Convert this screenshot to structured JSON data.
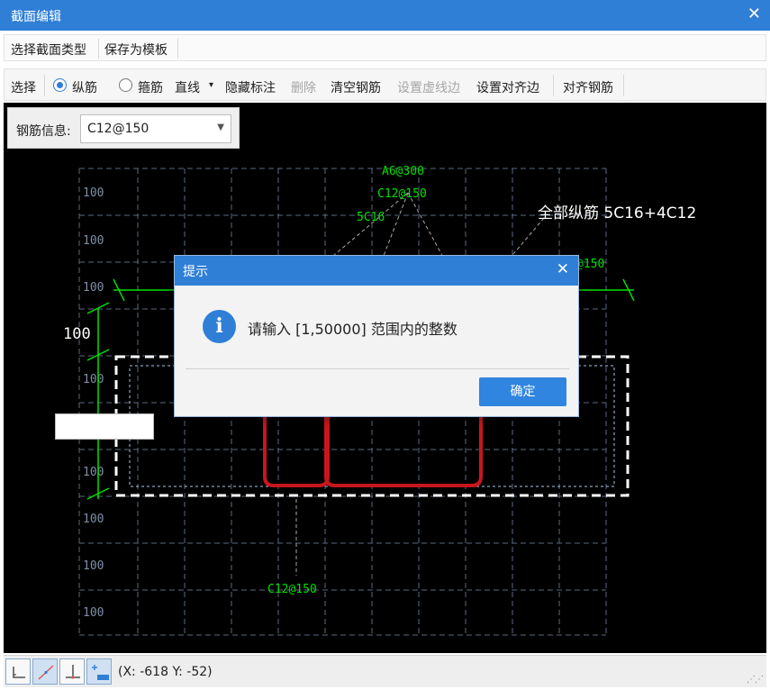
{
  "window": {
    "title": "截面编辑",
    "close_icon": "close-icon"
  },
  "menu": {
    "select_section_type": "选择截面类型",
    "save_as_template": "保存为模板"
  },
  "toolbar": {
    "select": "选择",
    "longitudinal": "纵筋",
    "stirrup": "箍筋",
    "line": "直线",
    "line_arrow": "▾",
    "hide_labels": "隐藏标注",
    "delete": "删除",
    "clear_rebar": "清空钢筋",
    "set_dashed_edge": "设置虚线边",
    "set_align_edge": "设置对齐边",
    "align_rebar": "对齐钢筋"
  },
  "rebar_info": {
    "label": "钢筋信息:",
    "value": "C12@150"
  },
  "drawing": {
    "grid_labels": [
      "100",
      "100",
      "100",
      "100",
      "100",
      "100",
      "100",
      "100",
      "100"
    ],
    "dim_value": "100",
    "annotations": {
      "stirrup_a": "A6@300",
      "rebar_top": "C12@150",
      "corner_bars": "5C16",
      "right_partial": "@150",
      "bottom_rebar": "C12@150",
      "all_longitudinal": "全部纵筋 5C16+4C12"
    },
    "colors": {
      "grid": "#5a6a80",
      "annotation": "#00e000",
      "dimension": "#00e000",
      "rebar": "#c8161d",
      "outline": "#ffffff"
    }
  },
  "dialog": {
    "title": "提示",
    "message": "请输入 [1,50000] 范围内的整数",
    "ok": "确定",
    "icon": "info-icon"
  },
  "status": {
    "coords": "(X: -618 Y: -52)"
  }
}
